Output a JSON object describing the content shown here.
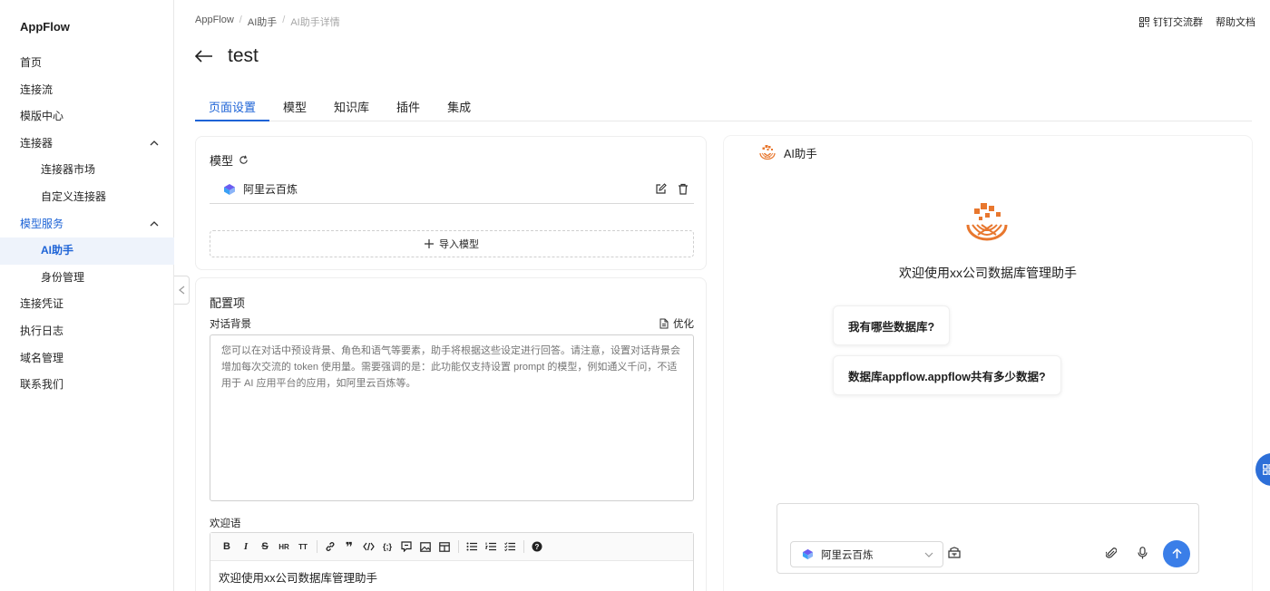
{
  "sidebar": {
    "brand": "AppFlow",
    "items": [
      {
        "label": "首页"
      },
      {
        "label": "连接流"
      },
      {
        "label": "模版中心"
      },
      {
        "label": "连接器"
      },
      {
        "label": "连接器市场"
      },
      {
        "label": "自定义连接器"
      },
      {
        "label": "模型服务"
      },
      {
        "label": "AI助手"
      },
      {
        "label": "身份管理"
      },
      {
        "label": "连接凭证"
      },
      {
        "label": "执行日志"
      },
      {
        "label": "域名管理"
      },
      {
        "label": "联系我们"
      }
    ]
  },
  "breadcrumb": {
    "items": [
      "AppFlow",
      "AI助手",
      "AI助手详情"
    ],
    "separator": "/"
  },
  "header": {
    "title": "test",
    "dingtalk_group": "钉钉交流群",
    "help_docs": "帮助文档"
  },
  "tabs": [
    {
      "label": "页面设置"
    },
    {
      "label": "模型"
    },
    {
      "label": "知识库"
    },
    {
      "label": "插件"
    },
    {
      "label": "集成"
    }
  ],
  "model_card": {
    "title": "模型",
    "model_name": "阿里云百炼",
    "import_label": "导入模型"
  },
  "config_card": {
    "title": "配置项",
    "background_label": "对话背景",
    "optimize_label": "优化",
    "background_placeholder": "您可以在对话中预设背景、角色和语气等要素，助手将根据这些设定进行回答。请注意，设置对话背景会增加每次交流的 token 使用量。需要强调的是：此功能仅支持设置 prompt 的模型，例如通义千问，不适用于 AI 应用平台的应用，如阿里云百炼等。",
    "welcome_label": "欢迎语",
    "welcome_content": "欢迎使用xx公司数据库管理助手"
  },
  "preview": {
    "title": "AI助手",
    "welcome": "欢迎使用xx公司数据库管理助手",
    "suggestions": [
      "我有哪些数据库?",
      "数据库appflow.appflow共有多少数据?"
    ],
    "model_select": "阿里云百炼"
  },
  "colors": {
    "accent": "#1d63d6",
    "brand_orange": "#e8772e",
    "send": "#3a7ee8"
  }
}
